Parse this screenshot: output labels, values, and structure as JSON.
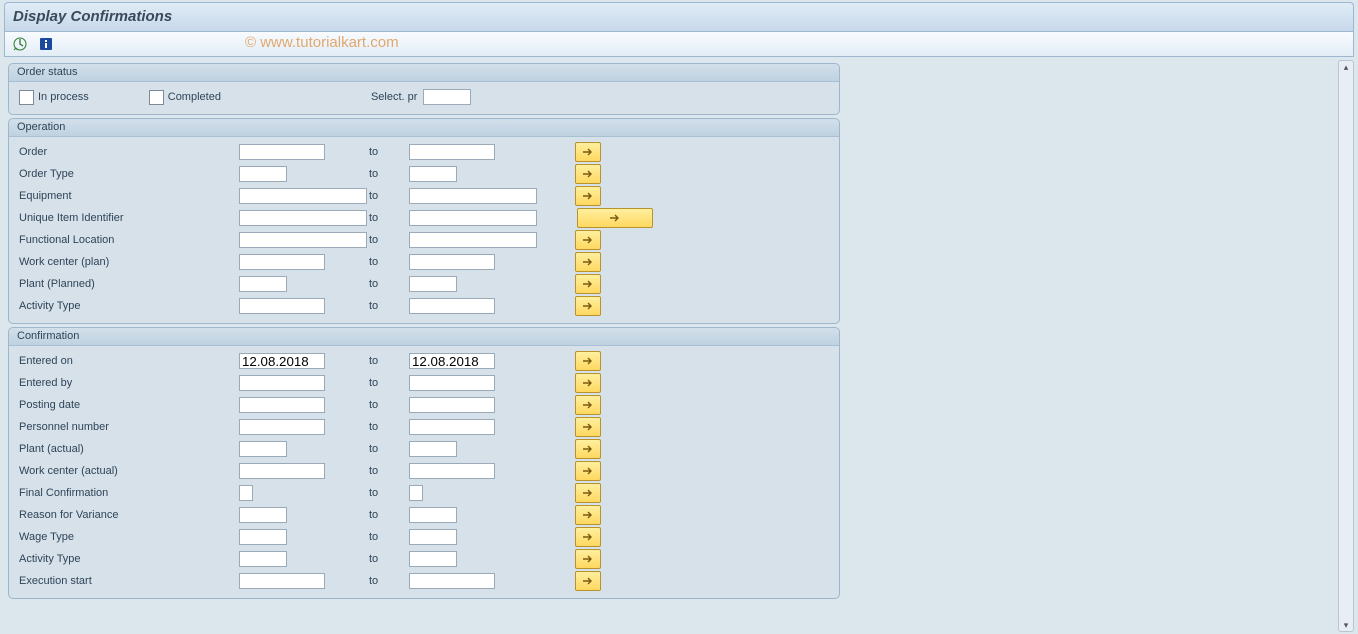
{
  "title": "Display Confirmations",
  "watermark": "© www.tutorialkart.com",
  "toolbar": {
    "execute_icon": "execute-icon",
    "info_icon": "info-icon"
  },
  "groups": {
    "order_status": {
      "title": "Order status",
      "in_process": "In process",
      "completed": "Completed",
      "select_profile_label": "Select. pr"
    },
    "operation": {
      "title": "Operation",
      "rows": [
        {
          "label": "Order",
          "from_w": "w80",
          "to_w": "w80",
          "mopt": "std"
        },
        {
          "label": "Order Type",
          "from_w": "w48",
          "to_w": "w48",
          "mopt": "std"
        },
        {
          "label": "Equipment",
          "from_w": "w128",
          "to_w": "w128",
          "mopt": "std"
        },
        {
          "label": "Unique Item Identifier",
          "from_w": "w128",
          "to_w": "w128",
          "mopt": "wide"
        },
        {
          "label": "Functional Location",
          "from_w": "w128",
          "to_w": "w128",
          "mopt": "std"
        },
        {
          "label": "Work center (plan)",
          "from_w": "w80",
          "to_w": "w80",
          "mopt": "std"
        },
        {
          "label": "Plant (Planned)",
          "from_w": "w48",
          "to_w": "w48",
          "mopt": "std"
        },
        {
          "label": "Activity Type",
          "from_w": "w80",
          "to_w": "w80",
          "mopt": "std"
        }
      ]
    },
    "confirmation": {
      "title": "Confirmation",
      "rows": [
        {
          "label": "Entered on",
          "from_w": "w80",
          "to_w": "w80",
          "mopt": "std",
          "from": "12.08.2018",
          "to": "12.08.2018"
        },
        {
          "label": "Entered by",
          "from_w": "w80",
          "to_w": "w80",
          "mopt": "std"
        },
        {
          "label": "Posting date",
          "from_w": "w80",
          "to_w": "w80",
          "mopt": "std"
        },
        {
          "label": "Personnel number",
          "from_w": "w80",
          "to_w": "w80",
          "mopt": "std"
        },
        {
          "label": "Plant (actual)",
          "from_w": "w48",
          "to_w": "w48",
          "mopt": "std"
        },
        {
          "label": "Work center (actual)",
          "from_w": "w80",
          "to_w": "w80",
          "mopt": "std"
        },
        {
          "label": "Final Confirmation",
          "from_w": "w12",
          "to_w": "w12",
          "mopt": "std"
        },
        {
          "label": "Reason for Variance",
          "from_w": "w48",
          "to_w": "w48",
          "mopt": "std"
        },
        {
          "label": "Wage Type",
          "from_w": "w48",
          "to_w": "w48",
          "mopt": "std"
        },
        {
          "label": "Activity Type",
          "from_w": "w48",
          "to_w": "w48",
          "mopt": "std"
        },
        {
          "label": "Execution start",
          "from_w": "w80",
          "to_w": "w80",
          "mopt": "std"
        }
      ]
    }
  },
  "to_label": "to"
}
